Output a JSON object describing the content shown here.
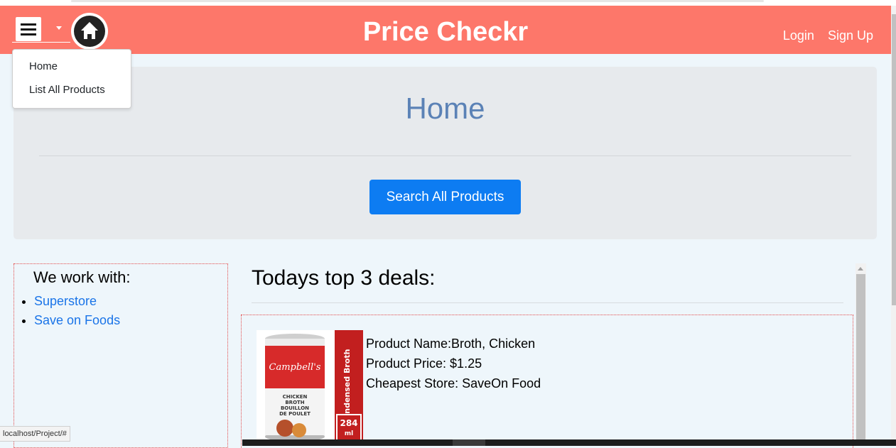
{
  "app": {
    "brand": "Price Checkr",
    "auth": {
      "login": "Login",
      "signup": "Sign Up"
    }
  },
  "menu": {
    "items": [
      {
        "label": "Home"
      },
      {
        "label": "List All Products"
      }
    ]
  },
  "hero": {
    "title": "Home",
    "search_button": "Search All Products"
  },
  "partners": {
    "heading": "We work with:",
    "stores": [
      {
        "label": "Superstore"
      },
      {
        "label": "Save on Foods"
      }
    ]
  },
  "deals": {
    "heading": "Todays top 3 deals:",
    "items": [
      {
        "name_line": "Product Name:Broth, Chicken",
        "price_line": "Product Price: $1.25",
        "store_line": "Cheapest Store: SaveOn Food",
        "image": {
          "brand": "Campbell's",
          "label_lines": [
            "CHICKEN",
            "BROTH",
            "BOUILLON",
            "DE POULET"
          ],
          "side_label": "Condensed Broth",
          "volume": "284",
          "volume_unit": "ml"
        }
      }
    ]
  },
  "status": {
    "url": "localhost/Project/#"
  },
  "colors": {
    "navbar": "#fd776a",
    "jumbotron": "#e7eaed",
    "primary_button": "#0d7cf2",
    "hero_title": "#5b82b6",
    "link": "#1a74e8",
    "dotted_border": "#e34b4b"
  }
}
